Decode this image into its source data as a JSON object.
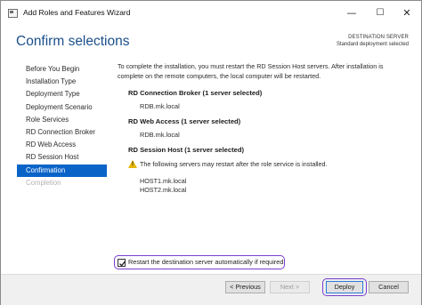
{
  "window": {
    "title": "Add Roles and Features Wizard",
    "minimize_symbol": "—",
    "maximize_symbol": "☐",
    "close_symbol": "✕"
  },
  "header": {
    "page_title": "Confirm selections",
    "destination_label": "DESTINATION SERVER",
    "destination_value": "Standard deployment selected"
  },
  "nav": {
    "items": [
      {
        "label": "Before You Begin",
        "state": "normal"
      },
      {
        "label": "Installation Type",
        "state": "normal"
      },
      {
        "label": "Deployment Type",
        "state": "normal"
      },
      {
        "label": "Deployment Scenario",
        "state": "normal"
      },
      {
        "label": "Role Services",
        "state": "normal"
      },
      {
        "label": "RD Connection Broker",
        "state": "normal"
      },
      {
        "label": "RD Web Access",
        "state": "normal"
      },
      {
        "label": "RD Session Host",
        "state": "normal"
      },
      {
        "label": "Confirmation",
        "state": "active"
      },
      {
        "label": "Completion",
        "state": "disabled"
      }
    ]
  },
  "main": {
    "intro": "To complete the installation, you must restart the RD Session Host servers. After installation is complete on the remote computers, the local computer will be restarted.",
    "sections": {
      "broker": {
        "heading": "RD Connection Broker  (1 server selected)",
        "value": "RDB.mk.local"
      },
      "web": {
        "heading": "RD Web Access  (1 server selected)",
        "value": "RDB.mk.local"
      },
      "session": {
        "heading": "RD Session Host  (1 server selected)",
        "warning": "The following servers may restart after the role service is installed.",
        "hosts": [
          "HOST1.mk.local",
          "HOST2.mk.local"
        ]
      }
    },
    "restart_checkbox": {
      "label": "Restart the destination server automatically if required",
      "checked": true
    }
  },
  "footer": {
    "previous_label": "< Previous",
    "next_label": "Next >",
    "deploy_label": "Deploy",
    "cancel_label": "Cancel"
  },
  "icons": {
    "app": "wizard-app-icon",
    "warning": "warning-icon",
    "check": "checkmark-icon"
  },
  "colors": {
    "accent": "#0a64c8",
    "title": "#1b4f8c",
    "highlight": "#7a3ccf",
    "warning": "#e6b400"
  }
}
